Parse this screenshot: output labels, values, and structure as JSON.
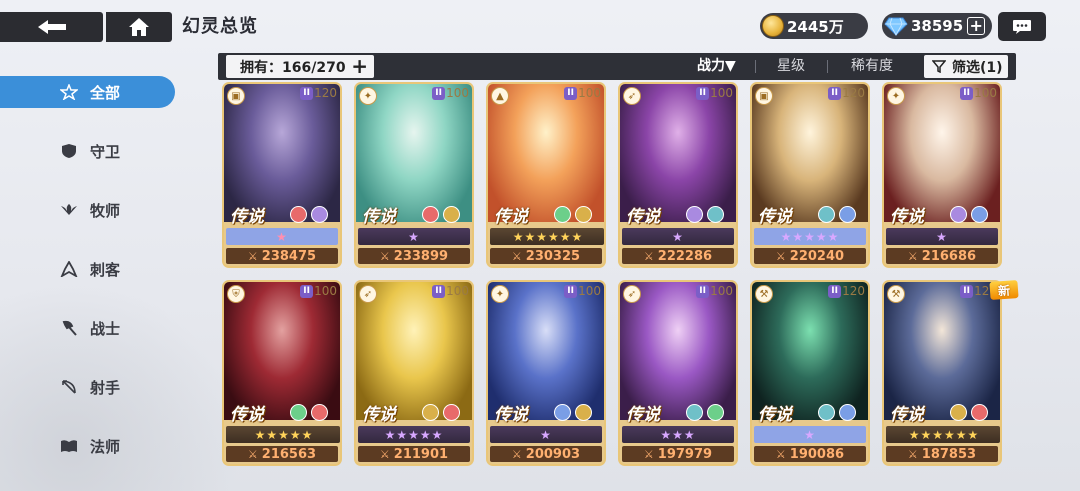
{
  "title": "幻灵总览",
  "currency": {
    "gold": "2445万",
    "gems": "38595",
    "gems_plus": "+"
  },
  "owned_label": "拥有：166/270",
  "owned_plus": "+",
  "sort": {
    "power": "战力▼",
    "star": "星级",
    "rarity": "稀有度"
  },
  "filter_label": "筛选(1)",
  "sidebar": [
    {
      "label": "全部",
      "icon": "all-star-icon",
      "active": true
    },
    {
      "label": "守卫",
      "icon": "shield-icon"
    },
    {
      "label": "牧师",
      "icon": "wings-icon"
    },
    {
      "label": "刺客",
      "icon": "blade-icon"
    },
    {
      "label": "战士",
      "icon": "axe-icon"
    },
    {
      "label": "射手",
      "icon": "bow-icon"
    },
    {
      "label": "法师",
      "icon": "book-icon"
    }
  ],
  "legend_text": "传说",
  "new_badge": "新",
  "colors": {
    "accent": "#3b8fd9",
    "topbar": "#2b2c31",
    "card_border": "#e9c678",
    "power_text": "#ffb070"
  },
  "cards": [
    {
      "level": "120",
      "power": "238475",
      "strip": "blue",
      "stars": "★",
      "role": "book-icon",
      "elements": [
        "swirl-icon",
        "crystal-icon"
      ]
    },
    {
      "level": "100",
      "power": "233899",
      "strip": "purple",
      "stars": "★",
      "role": "wings-icon",
      "elements": [
        "swirl-icon",
        "wings-element-icon"
      ]
    },
    {
      "level": "100",
      "power": "230325",
      "strip": "gold",
      "stars": "★★★★★★",
      "role": "blade-icon",
      "elements": [
        "leaf-icon",
        "wings-element-icon"
      ]
    },
    {
      "level": "100",
      "power": "222286",
      "strip": "purple",
      "stars": "★",
      "role": "bow-icon",
      "elements": [
        "crystal-icon",
        "orb-icon"
      ]
    },
    {
      "level": "120",
      "power": "220240",
      "strip": "bluep",
      "stars": "★★★★★",
      "role": "book-icon",
      "elements": [
        "orb-icon",
        "spark-icon"
      ]
    },
    {
      "level": "100",
      "power": "216686",
      "strip": "purple",
      "stars": "★",
      "role": "wings-icon",
      "elements": [
        "crystal-icon",
        "spark-icon"
      ]
    },
    {
      "level": "100",
      "power": "216563",
      "strip": "gold",
      "stars": "★★★★★",
      "role": "shield-icon",
      "elements": [
        "leaf-icon",
        "swirl-icon"
      ]
    },
    {
      "level": "100",
      "power": "211901",
      "strip": "purple",
      "stars": "★★★★★",
      "role": "bow-icon",
      "elements": [
        "wings-element-icon",
        "swirl-icon"
      ]
    },
    {
      "level": "100",
      "power": "200903",
      "strip": "purple",
      "stars": "★",
      "role": "wings-icon",
      "elements": [
        "spark-icon",
        "wings-element-icon"
      ]
    },
    {
      "level": "100",
      "power": "197979",
      "strip": "purple",
      "stars": "★★★",
      "role": "bow-icon",
      "elements": [
        "orb-icon",
        "leaf-icon"
      ]
    },
    {
      "level": "120",
      "power": "190086",
      "strip": "bluep",
      "stars": "★",
      "role": "axe-icon",
      "elements": [
        "orb-icon",
        "spark-icon"
      ]
    },
    {
      "level": "120",
      "power": "187853",
      "strip": "gold",
      "stars": "★★★★★★",
      "role": "axe-icon",
      "elements": [
        "wings-element-icon",
        "swirl-icon"
      ]
    }
  ]
}
